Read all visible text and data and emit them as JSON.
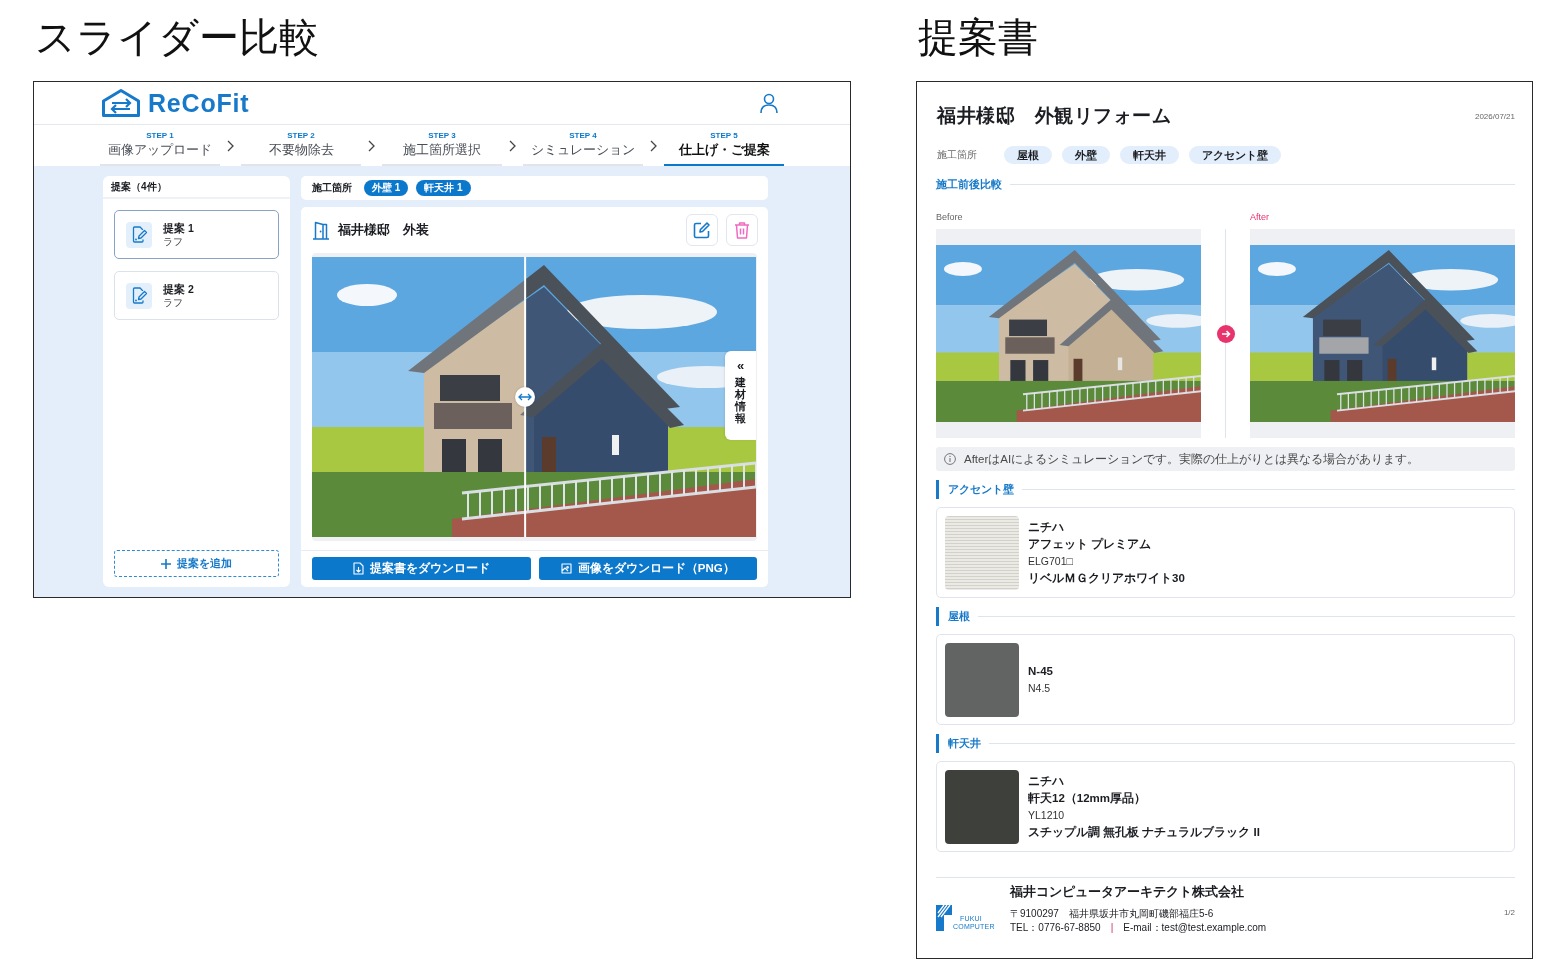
{
  "slider_view": {
    "heading": "スライダー比較",
    "app": {
      "logo": "ReCoFit",
      "steps": [
        {
          "step": "STEP 1",
          "label": "画像アップロード",
          "selected": false
        },
        {
          "step": "STEP 2",
          "label": "不要物除去",
          "selected": false
        },
        {
          "step": "STEP 3",
          "label": "施工箇所選択",
          "selected": false
        },
        {
          "step": "STEP 4",
          "label": "シミュレーション",
          "selected": false
        },
        {
          "step": "STEP 5",
          "label": "仕上げ・ご提案",
          "selected": true
        }
      ],
      "sidebar": {
        "title": "提案（4件）",
        "items": [
          {
            "title": "提案 1",
            "subtitle": "ラフ",
            "selected": true
          },
          {
            "title": "提案 2",
            "subtitle": "ラフ",
            "selected": false
          }
        ],
        "add_button": "提案を追加"
      },
      "locations": {
        "label": "施工箇所",
        "tags": [
          "外壁 1",
          "軒天井 1"
        ]
      },
      "viewer": {
        "title": "福井様邸　外装",
        "comparison": {
          "level": 0.48
        },
        "side_tab": {
          "arrow": "«",
          "label": "建材情報"
        },
        "buttons": [
          {
            "label": "提案書をダウンロード",
            "kind": "document"
          },
          {
            "label": "画像をダウンロード（PNG）",
            "kind": "image"
          }
        ]
      }
    }
  },
  "document": {
    "heading": "提案書",
    "title": "福井様邸　外観リフォーム",
    "date": "2026/07/21",
    "locations": {
      "label": "施工箇所",
      "tags": [
        "屋根",
        "外壁",
        "軒天井",
        "アクセント壁"
      ]
    },
    "comparison": {
      "title": "施工前後比較",
      "panels": [
        {
          "label": "Before",
          "kind": "before"
        },
        {
          "label": "After",
          "kind": "after"
        }
      ],
      "note": "AfterはAIによるシミュレーションです。実際の仕上がりとは異なる場合があります。"
    },
    "materials": [
      {
        "title": "アクセント壁",
        "swatch": {
          "kind": "texture",
          "color": "#ebeae5"
        },
        "lines": [
          {
            "text": "ニチハ",
            "kind": "name"
          },
          {
            "text": "アフェット プレミアム",
            "kind": "name"
          },
          {
            "text": "ELG701□",
            "kind": "code"
          },
          {
            "text": "リベルＭＧクリアホワイト30",
            "kind": "name"
          }
        ]
      },
      {
        "title": "屋根",
        "swatch": {
          "kind": "solid",
          "color": "#616463"
        },
        "lines": [
          {
            "text": "N-45",
            "kind": "name"
          },
          {
            "text": "N4.5",
            "kind": "code"
          }
        ]
      },
      {
        "title": "軒天井",
        "swatch": {
          "kind": "solid",
          "color": "#3e403c"
        },
        "lines": [
          {
            "text": "ニチハ",
            "kind": "name"
          },
          {
            "text": "軒天12（12mm厚品）",
            "kind": "name"
          },
          {
            "text": "YL1210",
            "kind": "code"
          },
          {
            "text": "スチップル調 無孔板 ナチュラルブラック II",
            "kind": "name"
          }
        ]
      }
    ],
    "footer": {
      "logo": [
        "FUKUI",
        "COMPUTER"
      ],
      "company": "福井コンピュータアーキテクト株式会社",
      "address": "〒9100297　福井県坂井市丸岡町磯部福庄5-6",
      "contact": [
        "TEL：0776-67-8850",
        "E-mail：test@test.example.com"
      ],
      "separator": "|",
      "page": "1/2"
    }
  }
}
